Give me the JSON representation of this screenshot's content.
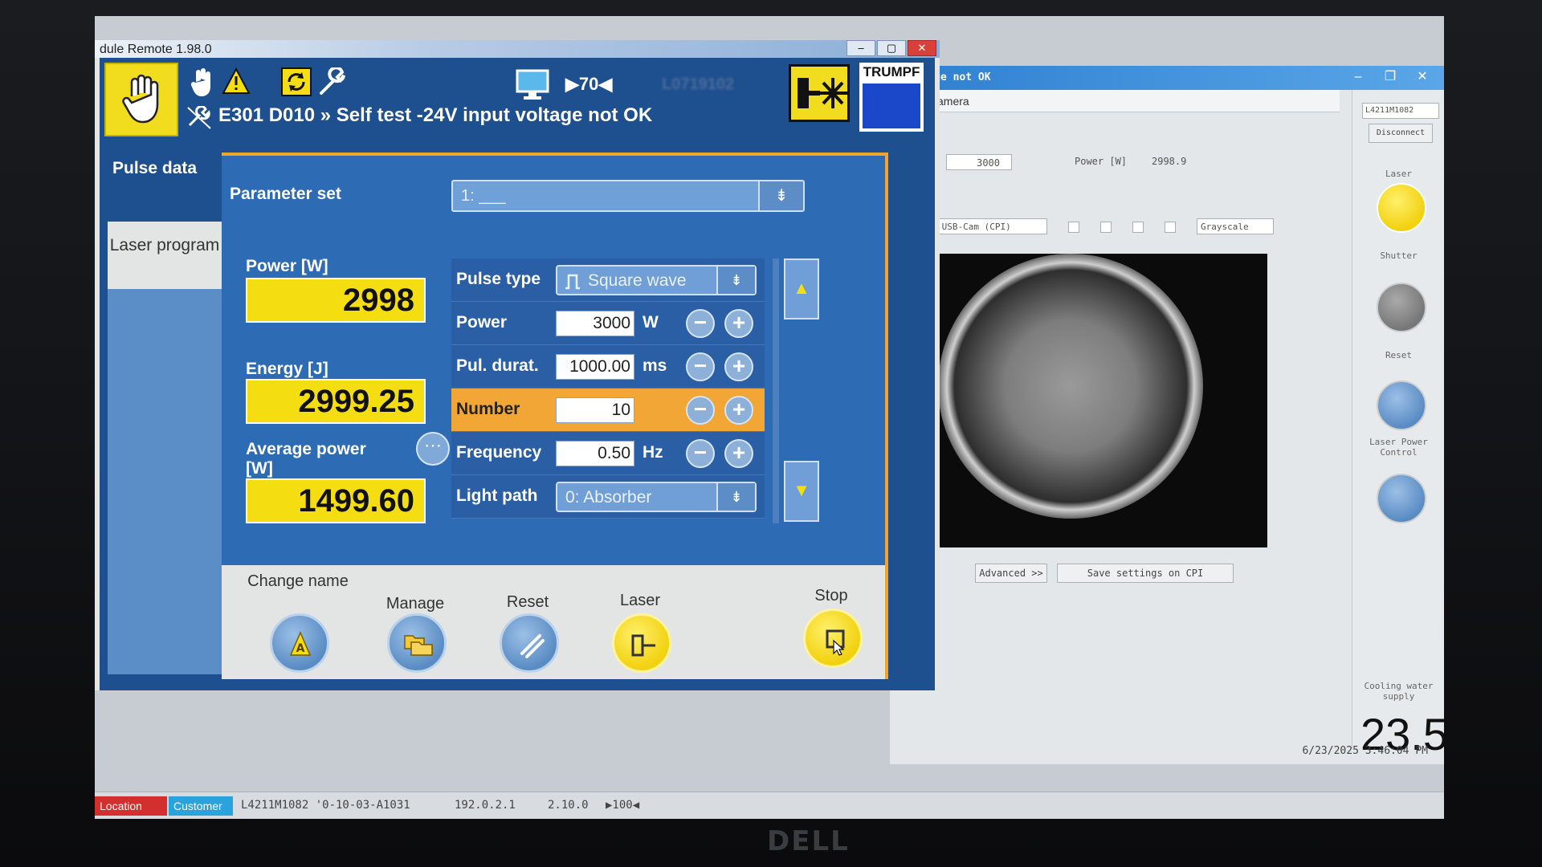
{
  "monitor": {
    "brand": "DELL"
  },
  "main_window": {
    "title": "dule Remote 1.98.0",
    "controls": {
      "minimize": "–",
      "maximize": "▢",
      "close": "✕"
    }
  },
  "header": {
    "error_message": "E301 D010 » Self test -24V input voltage not OK",
    "cycle_value": "▶70◀",
    "serial_blurred": "L0719102",
    "brand": "TRUMPF"
  },
  "tabs": {
    "pulse_data": "Pulse data",
    "laser_program": "Laser program"
  },
  "parameter_set": {
    "label": "Parameter set",
    "value": "1: ___"
  },
  "readouts": {
    "power_label": "Power [W]",
    "power_value": "2998",
    "energy_label": "Energy [J]",
    "energy_value": "2999.25",
    "avg_power_label": "Average power [W]",
    "avg_power_value": "1499.60"
  },
  "params": {
    "pulse_type": {
      "label": "Pulse type",
      "value": "Square wave"
    },
    "power": {
      "label": "Power",
      "value": "3000",
      "unit": "W"
    },
    "pulse_duration": {
      "label": "Pul. durat.",
      "value": "1000.00",
      "unit": "ms"
    },
    "number": {
      "label": "Number",
      "value": "10"
    },
    "frequency": {
      "label": "Frequency",
      "value": "0.50",
      "unit": "Hz"
    },
    "light_path": {
      "label": "Light path",
      "value": "0: Absorber"
    }
  },
  "actions": {
    "change_name": "Change name",
    "manage": "Manage",
    "reset": "Reset",
    "laser": "Laser",
    "stop": "Stop"
  },
  "background_app": {
    "title": "voltage not OK",
    "tab": "hots - Camera",
    "power_set": "3000",
    "power_readout_label": "Power [W]",
    "power_readout": "2998.9",
    "camera": "Logitech USB-Cam (CPI)",
    "mode": "Grayscale",
    "advanced": "Advanced >>",
    "save_settings": "Save settings on CPI",
    "device_id": "L4211M1082",
    "disconnect": "Disconnect",
    "right_labels": [
      "Laser",
      "Shutter",
      "Reset",
      "Laser Power Control",
      "Cooling water supply"
    ],
    "temperature": "23.5",
    "datetime": "6/23/2025 3:46:04 PM"
  },
  "statusbar": {
    "location": "Location",
    "customer": "Customer",
    "device": "L4211M1082 '0-10-03-A1031",
    "ip": "192.0.2.1",
    "version": "2.10.0",
    "cycle": "▶100◀"
  },
  "colors": {
    "trumpf_blue": "#1e4f8e",
    "accent_yellow": "#f4de12",
    "highlight_orange": "#f2a635"
  }
}
